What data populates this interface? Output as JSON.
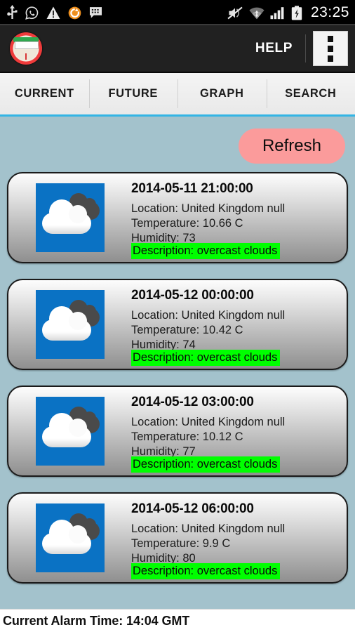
{
  "statusbar": {
    "time": "23:25",
    "left_icons": [
      "usb-icon",
      "whatsapp-icon",
      "warning-icon",
      "sync-icon",
      "messaging-icon"
    ],
    "right_icons": [
      "mute-icon",
      "wifi-icon",
      "signal-icon",
      "battery-charging-icon"
    ]
  },
  "appbar": {
    "logo_name": "app-logo-icon",
    "help_label": "HELP",
    "overflow_label": "overflow-menu"
  },
  "tabs": [
    {
      "label": "CURRENT",
      "selected": false
    },
    {
      "label": "FUTURE",
      "selected": true
    },
    {
      "label": "GRAPH",
      "selected": false
    },
    {
      "label": "SEARCH",
      "selected": false
    }
  ],
  "toolbar": {
    "refresh_label": "Refresh"
  },
  "forecast": [
    {
      "date": "2014-05-11 21:00:00",
      "location": "Location: United Kingdom null",
      "temperature": "Temperature: 10.66 C",
      "humidity": "Humidity: 73",
      "description": "Description: overcast clouds",
      "icon": "overcast-clouds-icon"
    },
    {
      "date": "2014-05-12 00:00:00",
      "location": "Location: United Kingdom null",
      "temperature": "Temperature: 10.42 C",
      "humidity": "Humidity: 74",
      "description": "Description: overcast clouds",
      "icon": "overcast-clouds-icon"
    },
    {
      "date": "2014-05-12 03:00:00",
      "location": "Location: United Kingdom null",
      "temperature": "Temperature: 10.12 C",
      "humidity": "Humidity: 77",
      "description": "Description: overcast clouds",
      "icon": "overcast-clouds-icon"
    },
    {
      "date": "2014-05-12 06:00:00",
      "location": "Location: United Kingdom null",
      "temperature": "Temperature: 9.9 C",
      "humidity": "Humidity: 80",
      "description": "Description: overcast clouds",
      "icon": "overcast-clouds-icon"
    }
  ],
  "bottombar": {
    "alarm_text": "Current Alarm Time: 14:04 GMT"
  },
  "colors": {
    "background": "#a3c2cc",
    "tab_accent": "#33b5e5",
    "refresh_button": "#fb9b9b",
    "description_highlight": "#00ff00",
    "weather_icon_background": "#0a72c4",
    "appbar": "#212121"
  }
}
